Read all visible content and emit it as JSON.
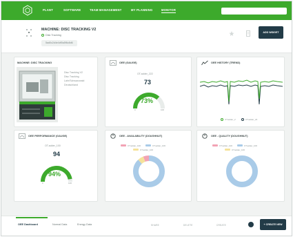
{
  "nav": {
    "items": [
      "PLANT",
      "SOFTWARE",
      "TEAM MANAGEMENT",
      "MY PLANNING",
      "MONITOR"
    ],
    "active": "MONITOR",
    "search_placeholder": ""
  },
  "header": {
    "title": "MACHINE: DISC TRACKING V2",
    "subtitle": "Disk Tracking",
    "id_chip": "5ad0c2d4e4df0a5f6c8d6"
  },
  "header_actions": {
    "add_widget_label": "ADD WIDGET"
  },
  "widgets": {
    "machine": {
      "title": "MACHINE: DISC TRACKING",
      "details": [
        "Disc Tracking V2",
        "Disc Tracking",
        "Lahr/Schwarzwald",
        "Deutschland"
      ]
    },
    "oee_gauge": {
      "title": "OEE (GAUGE)",
      "tag": "OT.adder_222",
      "value": "73",
      "percent_label": "73%",
      "percent": 73,
      "min_label": "0",
      "max_label": "100"
    },
    "oee_history": {
      "title": "OEE HISTORY (TREND)",
      "legend": [
        "OT.adder_2",
        "OT.adder_24"
      ]
    },
    "oee_performance": {
      "title": "OEE PERFORMANCE (GAUGE)",
      "tag": "OT.adder_100",
      "value": "94",
      "percent_label": "94%",
      "percent": 94,
      "min_label": "0",
      "max_label": "100"
    },
    "oee_availability": {
      "title": "OEE - AVAILABILITY (DOUGHNUT)",
      "legend": [
        "OT.adder_100",
        "OT.adder_106",
        "OT.adder_106"
      ],
      "segments": [
        {
          "value": 88,
          "color": "#a9cbe8"
        },
        {
          "value": 6,
          "color": "#f5e29a"
        },
        {
          "value": 6,
          "color": "#f2a3b4"
        }
      ]
    },
    "oee_quality": {
      "title": "OEE - QUALITY (DOUGHNUT)",
      "legend": [
        "OT.adder_100",
        "OT.adder_106",
        "OT.adder_106"
      ],
      "segments": [
        {
          "value": 100,
          "color": "#a9cbe8"
        }
      ]
    }
  },
  "bottom": {
    "tabs": [
      "OEE Dashboard",
      "Normal Data",
      "Energy Data"
    ],
    "actions": [
      "SHARE",
      "DELETE",
      "CREATE"
    ],
    "create_label": "+ CREATE NEW"
  },
  "colors": {
    "brand_green": "#3daa2c",
    "dark_navy": "#223b47",
    "doughnut_blue": "#a9cbe8",
    "legend_red": "#f2a3b4",
    "legend_yellow": "#f5e29a"
  },
  "icons": [
    "logo-hexagon-icon",
    "machine-icon",
    "gauge-icon",
    "trend-icon",
    "doughnut-icon",
    "star-icon",
    "document-icon",
    "circle-action-icon"
  ]
}
